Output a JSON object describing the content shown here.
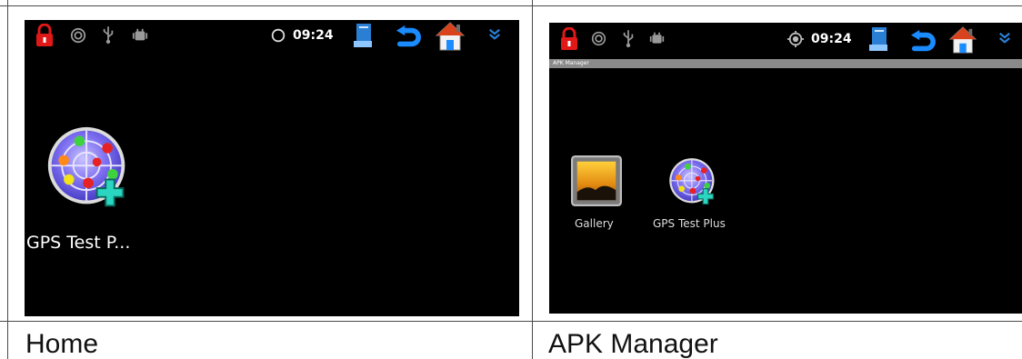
{
  "home": {
    "caption": "Home",
    "clock": "09:24",
    "apps": [
      {
        "label": "GPS Test P...",
        "icon": "gps-test-plus-icon"
      }
    ],
    "status_icons": [
      "lock-icon",
      "gps-status-icon",
      "usb-icon",
      "android-debug-icon",
      "sync-icon",
      "notes-icon",
      "back-icon",
      "home-icon",
      "expand-chevron-icon"
    ]
  },
  "apk_manager": {
    "caption": "APK Manager",
    "title": "APK Manager",
    "clock": "09:24",
    "apps": [
      {
        "label": "Gallery",
        "icon": "gallery-icon"
      },
      {
        "label": "GPS Test Plus",
        "icon": "gps-test-plus-icon"
      }
    ],
    "status_icons": [
      "lock-icon",
      "gps-status-icon",
      "usb-icon",
      "android-debug-icon",
      "gps-fix-icon",
      "notes-icon",
      "back-icon",
      "home-icon",
      "expand-chevron-icon"
    ]
  },
  "colors": {
    "lock": "#e01818",
    "back": "#1a8cff",
    "chevron": "#2a7fd4",
    "screen": "#000000"
  }
}
